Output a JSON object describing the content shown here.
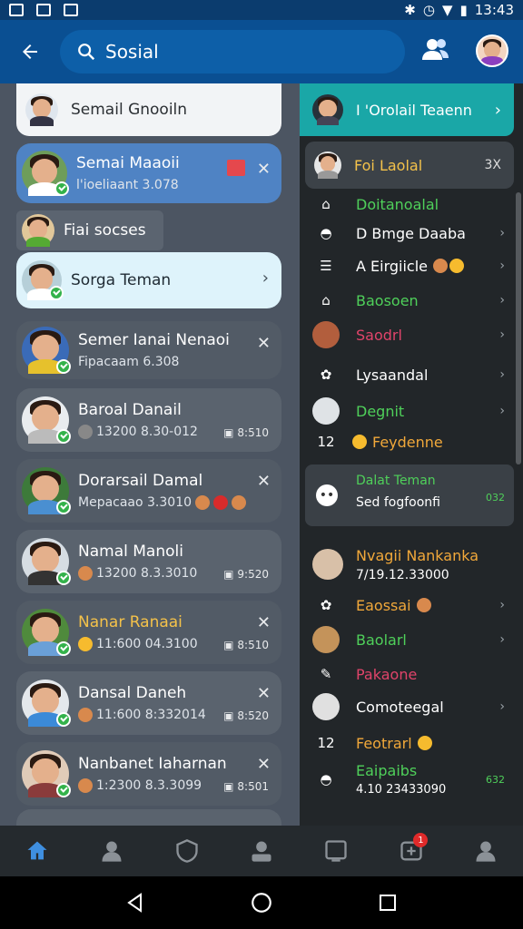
{
  "status_bar": {
    "time": "13:43"
  },
  "app_bar": {
    "back_icon": "arrow-left-icon",
    "search_text": "Sosial",
    "people_icon": "people-icon"
  },
  "left_panel": {
    "top_card": {
      "name": "Semail Gnooiln"
    },
    "items": [
      {
        "name": "Semai Maaoii",
        "sub": "l'ioeliaant 3.078",
        "highlight": "blue"
      },
      {
        "name": "Fiai socses"
      },
      {
        "name": "Sorga Teman"
      },
      {
        "name": "Semer Ianai Nenaoi",
        "sub": "Fipacaam 6.308"
      },
      {
        "name": "Baroal Danail",
        "sub": "13200 8.30-012",
        "meta": "8:510"
      },
      {
        "name": "Dorarsail Damal",
        "sub": "Mepacaao 3.3010"
      },
      {
        "name": "Namal Manoli",
        "sub": "13200 8.3.3010",
        "meta": "9:520"
      },
      {
        "name": "Nanar Ranaai",
        "sub": "11:600 04.3100",
        "meta": "8:510"
      },
      {
        "name": "Dansal Daneh",
        "sub": "11:600 8:332014",
        "meta": "8:520"
      },
      {
        "name": "Nanbanet Iaharnan",
        "sub": "1:2300 8.3.3099",
        "meta": "8:501"
      }
    ]
  },
  "right_panel": {
    "header": {
      "title": "I 'Orolail Teaenn"
    },
    "selected": {
      "name": "Foi Laolal",
      "meta": "3X"
    },
    "rows": [
      {
        "label": "Doitanoalal",
        "color": "#4fd05a",
        "icon": "group-icon"
      },
      {
        "label": "D Bmge Daaba",
        "color": "#ffffff",
        "icon": "mask-icon"
      },
      {
        "label": "A Eirgiicle",
        "color": "#ffffff",
        "icon": "list-icon"
      },
      {
        "label": "Baosoen",
        "color": "#4fd05a",
        "icon": "home-icon"
      },
      {
        "label": "Saodrl",
        "color": "#e0446a",
        "icon": "avatar"
      },
      {
        "label": "Lysaandal",
        "color": "#ffffff",
        "icon": "settings-icon"
      },
      {
        "label": "Degnit",
        "color": "#4fd05a",
        "icon": "avatar"
      },
      {
        "label": "Feydenne",
        "color": "#f1a83a",
        "icon": "number-icon"
      }
    ],
    "card": {
      "title": "Dalat Teman",
      "sub": "Sed fogfoonfi",
      "meta": "032"
    },
    "lower": [
      {
        "label": "Nvagii Nankanka",
        "sub": "7/19.12.33000",
        "color": "#f1a83a"
      },
      {
        "label": "Eaossai",
        "color": "#f1a83a"
      },
      {
        "label": "Baolarl",
        "color": "#4fd05a"
      },
      {
        "label": "Pakaone",
        "color": "#e0446a"
      },
      {
        "label": "Comoteegal",
        "color": "#ffffff"
      },
      {
        "label": "Feotrarl",
        "color": "#f1a83a"
      },
      {
        "label": "Eaipaibs",
        "sub": "4.10 23433090",
        "color": "#4fd05a",
        "meta": "632"
      }
    ]
  },
  "bottom_nav": {
    "badge": "1"
  }
}
